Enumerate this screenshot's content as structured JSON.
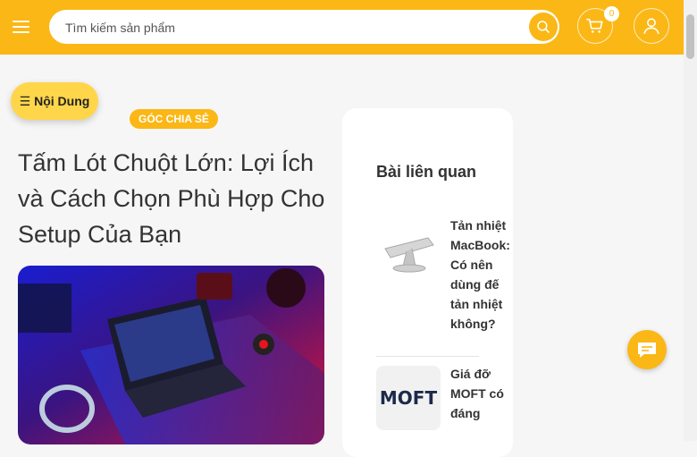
{
  "header": {
    "search": {
      "placeholder": "Tìm kiếm sản phẩm",
      "value": ""
    },
    "cart_count": "0",
    "icons": {
      "menu": "hamburger-icon",
      "search": "search-icon",
      "cart": "cart-icon",
      "user": "user-icon"
    }
  },
  "colors": {
    "brand": "#fbb715",
    "toc": "#ffd64a",
    "text": "#333333",
    "background": "#f6f6f6"
  },
  "toc": {
    "label": "☰ Nội Dung"
  },
  "article": {
    "category": "GÓC CHIA SẺ",
    "title": "Tấm Lót Chuột Lớn: Lợi Ích và Cách Chọn Phù Hợp Cho Setup Của Bạn"
  },
  "sidebar": {
    "title": "Bài liên quan",
    "posts": [
      {
        "title": "Tản nhiệt MacBook: Có nên dùng đế tản nhiệt không?"
      },
      {
        "title": "Giá đỡ MOFT có đáng",
        "logo_text": "MOFT"
      }
    ]
  },
  "chat": {
    "icon": "chat-icon"
  }
}
